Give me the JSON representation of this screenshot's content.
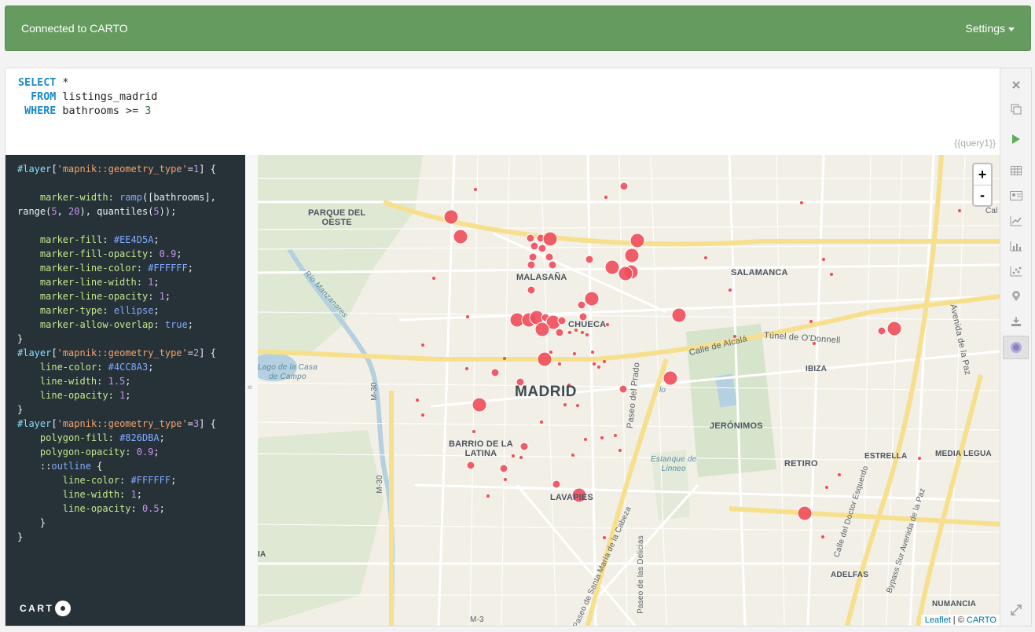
{
  "topbar": {
    "title": "Connected to CARTO",
    "settings_label": "Settings"
  },
  "editor": {
    "sql_lines": [
      {
        "kw": "SELECT",
        "rest": " *",
        "indent": ""
      },
      {
        "kw": "FROM",
        "rest": " listings_madrid",
        "indent": "  "
      },
      {
        "kw": "WHERE",
        "rest": " bathrooms >= ",
        "num": "3",
        "indent": " "
      }
    ],
    "query_tag": "{{query1}}"
  },
  "cartocss": {
    "logo_text": "CART"
  },
  "map": {
    "zoom_in": "+",
    "zoom_out": "-",
    "collapse_glyph": "«",
    "attribution_leaflet": "Leaflet",
    "attribution_sep": " | © ",
    "attribution_carto": "CARTO",
    "labels": {
      "parque": "PARQUE DEL\nOESTE",
      "malasana": "MALASAÑA",
      "salamanca": "SALAMANCA",
      "chueca": "CHUECA",
      "madrid": "MADRID",
      "jeronimos": "JERÓNIMOS",
      "barrio": "BARRIO DE LA\nLATINA",
      "lavapies": "LAVAPIES",
      "retiro": "RETIRO",
      "estrella": "ESTRELLA",
      "media_legua": "MEDIA LEGUA",
      "ibiza": "IBIZA",
      "adelfas": "ADELFAS",
      "numancia": "NUMANCIA",
      "calle_alcala": "Calle de Alcalá",
      "tunel": "Túnel de O'Donnell",
      "lago": "Lago de la Casa\nde Campo",
      "estanque": "Estanque de\nLinneo",
      "paseo_prado": "Paseo del Prado",
      "m30a": "M-30",
      "m30b": "M-30",
      "rio": "Río Manzanares",
      "avenida_paz": "Avenida de la Paz",
      "bypass": "Bypass Sur Avenida de la Paz",
      "doctor": "Calle del Doctor Esquerdo",
      "santa_maria": "Paseo de Santa María de la Cabeza",
      "delicias": "Paseo de las Delicias",
      "cal": "Cal",
      "lo": "lo",
      "ia": "IA",
      "m3": "M-3"
    },
    "marker_color": "#EE4D5A"
  },
  "sidebar_icons": [
    "close-icon",
    "copy-icon",
    "run-icon",
    "table-icon",
    "card-icon",
    "line-chart-icon",
    "bar-chart-icon",
    "scatter-icon",
    "map-pin-icon",
    "download-icon",
    "map-view-icon",
    "expand-icon"
  ]
}
